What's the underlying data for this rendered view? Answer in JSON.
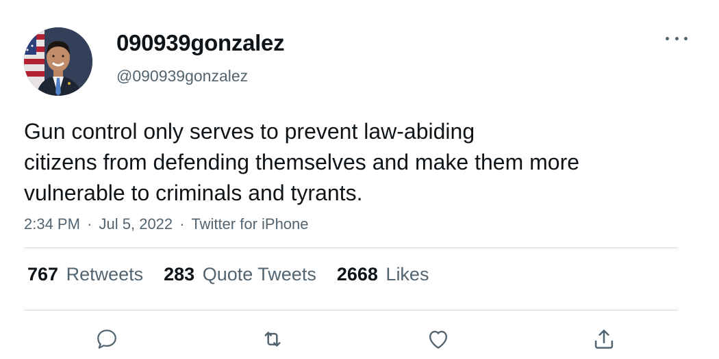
{
  "tweet": {
    "display_name": "090939gonzalez",
    "handle": "@090939gonzalez",
    "text_lines": [
      "Gun control only serves to prevent law-abiding",
      "citizens from defending themselves and make them more",
      "vulnerable to criminals and tyrants."
    ],
    "time": "2:34 PM",
    "date": "Jul 5, 2022",
    "source": "Twitter for iPhone",
    "separator": "·"
  },
  "stats": {
    "retweets_count": "767",
    "retweets_label": "Retweets",
    "quotes_count": "283",
    "quotes_label": "Quote Tweets",
    "likes_count": "2668",
    "likes_label": "Likes"
  },
  "icons": {
    "avatar": "profile-photo",
    "more": "more-icon",
    "reply": "reply-icon",
    "retweet": "retweet-icon",
    "like": "like-icon",
    "share": "share-icon"
  },
  "colors": {
    "text_primary": "#0f1419",
    "text_secondary": "#536471",
    "divider": "#cfd9de"
  }
}
